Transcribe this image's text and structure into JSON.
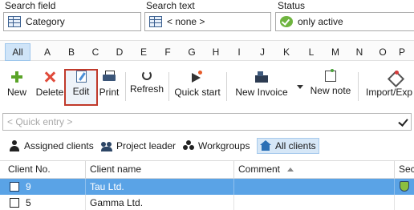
{
  "filters": {
    "search_field": {
      "label": "Search field",
      "value": "Category"
    },
    "search_text": {
      "label": "Search text",
      "value": "< none >"
    },
    "status": {
      "label": "Status",
      "value": "only active"
    }
  },
  "alphabet": [
    "All",
    "A",
    "B",
    "C",
    "D",
    "E",
    "F",
    "G",
    "H",
    "I",
    "J",
    "K",
    "L",
    "M",
    "N",
    "O",
    "P"
  ],
  "toolbar": {
    "new": "New",
    "delete": "Delete",
    "edit": "Edit",
    "print": "Print",
    "refresh": "Refresh",
    "quick_start": "Quick start",
    "new_invoice": "New Invoice",
    "new_note": "New note",
    "import_export": "Import/Exp"
  },
  "quick_entry": {
    "placeholder": "< Quick entry >"
  },
  "views": {
    "assigned": "Assigned clients",
    "project_leader": "Project leader",
    "workgroups": "Workgroups",
    "all": "All clients"
  },
  "table": {
    "columns": [
      "Client No.",
      "Client name",
      "Comment",
      "Sec"
    ],
    "rows": [
      {
        "no": "9",
        "name": "Tau Ltd.",
        "comment": "",
        "selected": true
      },
      {
        "no": "5",
        "name": "Gamma Ltd.",
        "comment": "",
        "selected": false
      }
    ]
  },
  "colors": {
    "selection": "#5aa3e6",
    "active_tab": "#d6e7f7",
    "highlight_border": "#c0392b"
  }
}
